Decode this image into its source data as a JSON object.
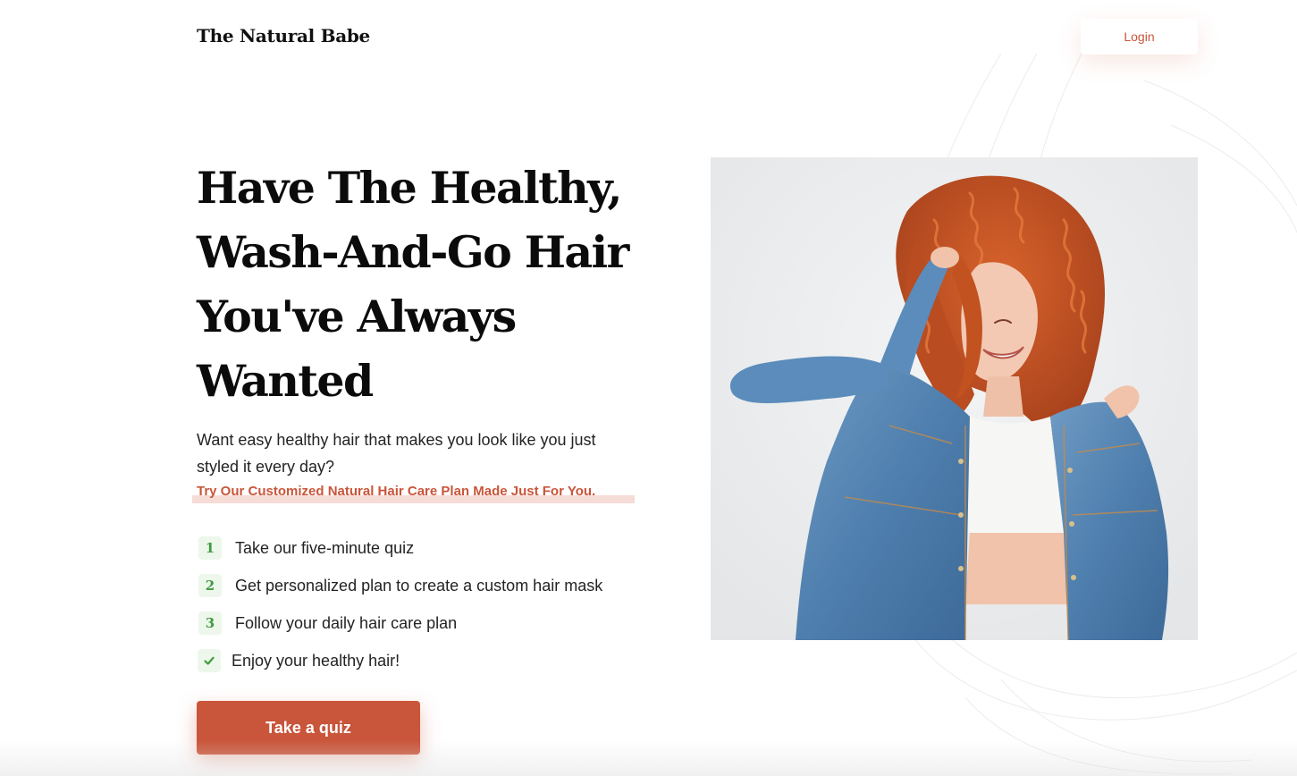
{
  "header": {
    "brand": "The Natural Babe",
    "login_label": "Login"
  },
  "hero": {
    "headline_lines": [
      "Have The Healthy,",
      "Wash-And-Go Hair",
      "You've Always",
      "Wanted"
    ],
    "subtext": "Want easy healthy hair that makes you look like you just styled it every day?",
    "highlight": "Try Our Customized Natural Hair Care Plan Made Just For You.",
    "steps": [
      {
        "marker": "1",
        "text": "Take our five-minute quiz"
      },
      {
        "marker": "2",
        "text": "Get personalized plan to create a custom hair mask"
      },
      {
        "marker": "3",
        "text": "Follow your daily hair care plan"
      },
      {
        "marker": "check-icon",
        "text": "Enjoy your healthy hair!"
      }
    ],
    "cta_label": "Take a quiz"
  },
  "colors": {
    "accent": "#c9553a",
    "highlight_bar": "#f6dcd6",
    "step_badge_bg": "#eef7ec",
    "step_badge_fg": "#3d9b3d",
    "photo_background": "#eceeef"
  }
}
